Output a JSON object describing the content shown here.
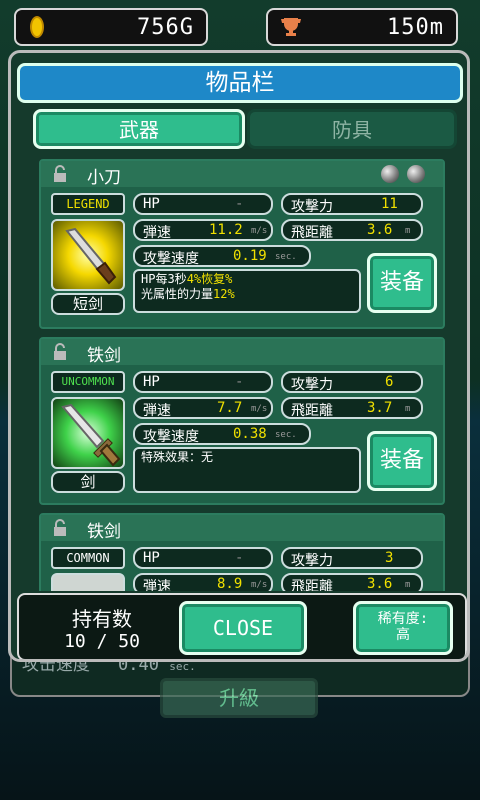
{
  "hud": {
    "gold": "756G",
    "distance": "150m"
  },
  "background": {
    "stat_label": "攻击速度",
    "stat_value": "0.40",
    "stat_unit": "sec.",
    "button_label": "升級"
  },
  "dialog": {
    "title": "物品栏",
    "tabs": {
      "weapon": "武器",
      "armor": "防具"
    },
    "labels": {
      "hp": "HP",
      "attack": "攻撃力",
      "bullet_speed": "弾速",
      "range": "飛距離",
      "attack_speed": "攻撃速度",
      "equip": "装备",
      "unit_speed": "m/s",
      "unit_range": "m",
      "unit_sec": "sec."
    },
    "items": [
      {
        "name": "小刀",
        "rarity": "LEGEND",
        "category": "短剑",
        "hp": "-",
        "attack": "11",
        "bullet_speed": "11.2",
        "range": "3.6",
        "attack_speed": "0.19",
        "effect_line1_prefix": "HP每3秒",
        "effect_line1_hl": "4%恢复%",
        "effect_line2_prefix": "光属性的力量",
        "effect_line2_hl": "12%"
      },
      {
        "name": "铁剑",
        "rarity": "UNCOMMON",
        "category": "剑",
        "hp": "-",
        "attack": "6",
        "bullet_speed": "7.7",
        "range": "3.7",
        "attack_speed": "0.38",
        "effect": "特殊效果：无"
      },
      {
        "name": "铁剑",
        "rarity": "COMMON",
        "hp": "-",
        "attack": "3",
        "bullet_speed": "8.9",
        "range": "3.6"
      }
    ],
    "footer": {
      "count_label": "持有数",
      "count_value": "10 / 50",
      "close": "CLOSE",
      "sort_line1": "稀有度:",
      "sort_line2": "高"
    }
  },
  "colors": {
    "accent": "#2fbd8d",
    "title_bar": "#1e88c8",
    "value_yellow": "#f0e000"
  }
}
